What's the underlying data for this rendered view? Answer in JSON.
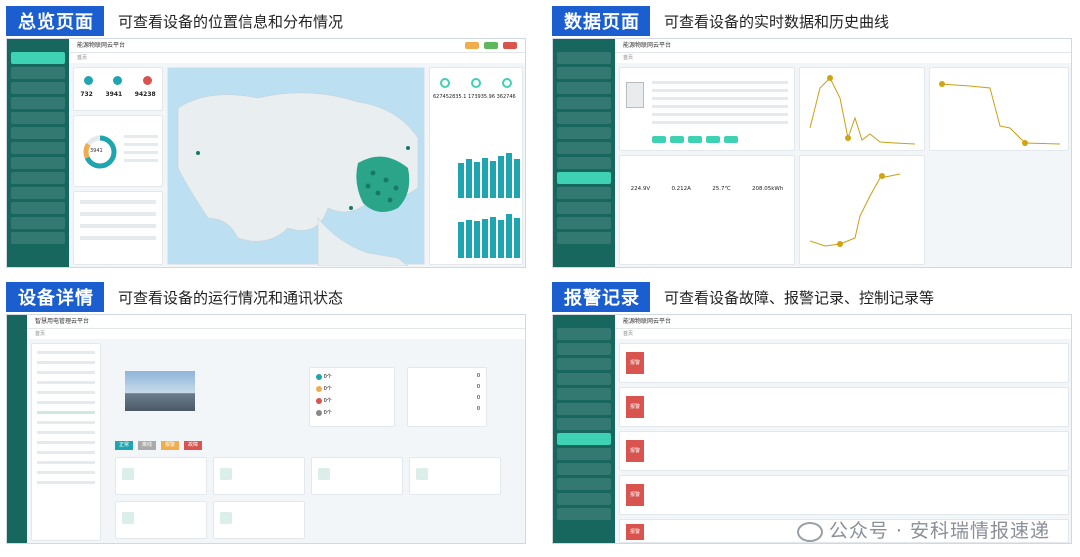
{
  "panels": [
    {
      "tag": "总览页面",
      "desc": "可查看设备的位置信息和分布情况"
    },
    {
      "tag": "数据页面",
      "desc": "可查看设备的实时数据和历史曲线"
    },
    {
      "tag": "设备详情",
      "desc": "可查看设备的运行情况和通讯状态"
    },
    {
      "tag": "报警记录",
      "desc": "可查看设备故障、报警记录、控制记录等"
    }
  ],
  "app": {
    "title_a": "能源物联网云平台",
    "title_b": "智慧用电管理云平台",
    "crumb": "首页"
  },
  "overview": {
    "stats": [
      {
        "value": "732"
      },
      {
        "value": "3941"
      },
      {
        "value": "94238"
      }
    ],
    "donut_value": "3941",
    "big_numbers": "627452835.1 173935.96 362746"
  },
  "data_page": {
    "readings": [
      "224.9V",
      "0.212A",
      "25.7℃",
      "208.05kWh"
    ]
  },
  "detail": {
    "counts": [
      "0个",
      "0个",
      "0个",
      "0个"
    ],
    "right_counts": [
      "0",
      "0",
      "0",
      "0"
    ],
    "buttons": [
      "正常",
      "离线",
      "报警",
      "故障"
    ]
  },
  "alarm": {
    "rows": [
      "报警",
      "报警",
      "报警",
      "报警",
      "报警"
    ]
  },
  "watermark": "公众号 · 安科瑞情报速递",
  "colors": {
    "tag_blue": "#1a5ed0",
    "sidebar_teal": "#17675f",
    "accent": "#3fd1b3",
    "alarm_red": "#d9534f"
  }
}
